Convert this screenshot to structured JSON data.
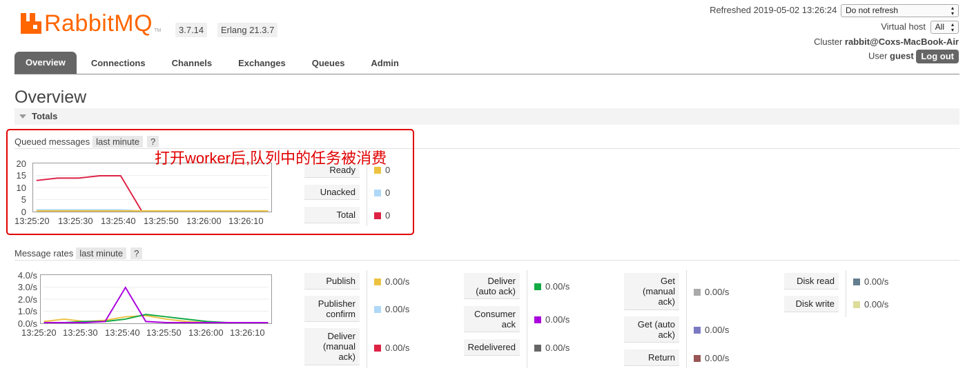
{
  "header": {
    "logo_text": "RabbitMQ",
    "logo_tm": "TM",
    "version": "3.7.14",
    "erlang": "Erlang 21.3.7",
    "refreshed": "Refreshed 2019-05-02 13:26:24",
    "refresh_select": "Do not refresh",
    "vhost_label": "Virtual host",
    "vhost_select": "All",
    "cluster_label": "Cluster",
    "cluster_value": "rabbit@Coxs-MacBook-Air",
    "user_label": "User",
    "user_value": "guest",
    "logout": "Log out"
  },
  "tabs": [
    "Overview",
    "Connections",
    "Channels",
    "Exchanges",
    "Queues",
    "Admin"
  ],
  "page_title": "Overview",
  "totals_label": "Totals",
  "annotation": "打开worker后,队列中的任务被消费",
  "queued": {
    "title": "Queued messages",
    "range": "last minute",
    "help": "?",
    "legend": [
      {
        "label": "Ready",
        "value": "0",
        "color": "#edc240"
      },
      {
        "label": "Unacked",
        "value": "0",
        "color": "#afd8f8"
      },
      {
        "label": "Total",
        "value": "0",
        "color": "#dd2244"
      }
    ]
  },
  "rates": {
    "title": "Message rates",
    "range": "last minute",
    "help": "?",
    "col1": [
      {
        "label": "Publish",
        "value": "0.00/s",
        "color": "#edc240"
      },
      {
        "label": "Publisher confirm",
        "value": "0.00/s",
        "color": "#afd8f8"
      },
      {
        "label": "Deliver (manual ack)",
        "value": "0.00/s",
        "color": "#dd2244"
      }
    ],
    "col2": [
      {
        "label": "Deliver (auto ack)",
        "value": "0.00/s",
        "color": "#11aa44"
      },
      {
        "label": "Consumer ack",
        "value": "0.00/s",
        "color": "#aa00dd"
      },
      {
        "label": "Redelivered",
        "value": "0.00/s",
        "color": "#666666"
      }
    ],
    "col3": [
      {
        "label": "Get (manual ack)",
        "value": "0.00/s",
        "color": "#aaaaaa"
      },
      {
        "label": "Get (auto ack)",
        "value": "0.00/s",
        "color": "#7c79c3"
      },
      {
        "label": "Return",
        "value": "0.00/s",
        "color": "#995555"
      }
    ],
    "col4": [
      {
        "label": "Disk read",
        "value": "0.00/s",
        "color": "#657e8f"
      },
      {
        "label": "Disk write",
        "value": "0.00/s",
        "color": "#dddd99"
      }
    ]
  },
  "chart_data": [
    {
      "type": "line",
      "title": "Queued messages",
      "x": [
        "13:25:20",
        "13:25:25",
        "13:25:30",
        "13:25:35",
        "13:25:40",
        "13:25:45",
        "13:25:50",
        "13:25:55",
        "13:26:00",
        "13:26:05",
        "13:26:10",
        "13:26:15"
      ],
      "xticks": [
        "13:25:20",
        "13:25:30",
        "13:25:40",
        "13:25:50",
        "13:26:00",
        "13:26:10"
      ],
      "yticks": [
        "20",
        "15",
        "10",
        "5",
        "0"
      ],
      "ylim": [
        0,
        20
      ],
      "series": [
        {
          "name": "Total",
          "color": "#dd2244",
          "values": [
            13,
            14,
            14,
            15,
            15,
            0,
            0,
            0,
            0,
            0,
            0,
            0
          ]
        },
        {
          "name": "Unacked",
          "color": "#afd8f8",
          "values": [
            0.5,
            0.5,
            0.5,
            0.5,
            0.5,
            0,
            0,
            0,
            0,
            0,
            0,
            0
          ]
        },
        {
          "name": "Ready",
          "color": "#edc240",
          "values": [
            0,
            0,
            0,
            0,
            0,
            0,
            0,
            0,
            0,
            0,
            0,
            0
          ]
        }
      ]
    },
    {
      "type": "line",
      "title": "Message rates",
      "x": [
        "13:25:20",
        "13:25:25",
        "13:25:30",
        "13:25:35",
        "13:25:40",
        "13:25:45",
        "13:25:50",
        "13:25:55",
        "13:26:00",
        "13:26:05",
        "13:26:10",
        "13:26:15"
      ],
      "xticks": [
        "13:25:20",
        "13:25:30",
        "13:25:40",
        "13:25:50",
        "13:26:00",
        "13:26:10"
      ],
      "yticks": [
        "4.0/s",
        "3.0/s",
        "2.0/s",
        "1.0/s",
        "0.0/s"
      ],
      "ylim": [
        0,
        4
      ],
      "series": [
        {
          "name": "Publish",
          "color": "#edc240",
          "values": [
            0.1,
            0.3,
            0.1,
            0.2,
            0.5,
            0.6,
            0.3,
            0.1,
            0,
            0,
            0,
            0
          ]
        },
        {
          "name": "Deliver (auto ack)",
          "color": "#11aa44",
          "values": [
            0,
            0,
            0.1,
            0.1,
            0.3,
            0.7,
            0.5,
            0.3,
            0.1,
            0,
            0,
            0
          ]
        },
        {
          "name": "Consumer ack",
          "color": "#aa00dd",
          "values": [
            0,
            0,
            0,
            0.1,
            3.0,
            0.1,
            0,
            0,
            0,
            0,
            0,
            0
          ]
        }
      ]
    }
  ]
}
